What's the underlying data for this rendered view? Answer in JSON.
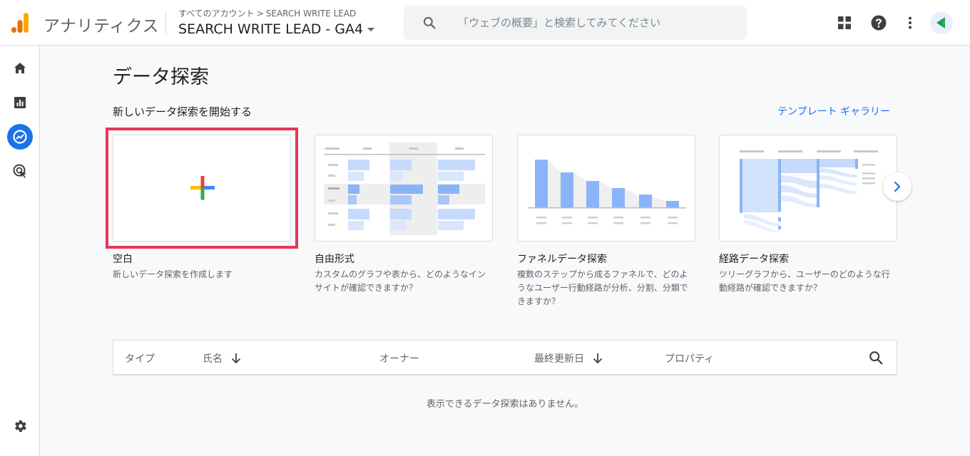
{
  "header": {
    "product_name": "アナリティクス",
    "breadcrumb": {
      "account": "すべてのアカウント",
      "separator": ">",
      "property": "SEARCH WRITE LEAD"
    },
    "property_name": "SEARCH WRITE LEAD - GA4",
    "search_placeholder": "「ウェブの概要」と検索してみてください",
    "icons": [
      "apps-icon",
      "help-icon",
      "more-vert-icon",
      "account-avatar"
    ]
  },
  "sidebar": {
    "items": [
      {
        "name": "home",
        "icon": "home-icon",
        "active": false
      },
      {
        "name": "reports",
        "icon": "reports-icon",
        "active": true
      },
      {
        "name": "explore",
        "icon": "explore-icon",
        "active": true
      },
      {
        "name": "advertising",
        "icon": "advertising-icon",
        "active": false
      },
      {
        "name": "admin",
        "icon": "gear-icon",
        "active": false
      }
    ]
  },
  "main": {
    "title": "データ探索",
    "section_title": "新しいデータ探索を開始する",
    "gallery_link": "テンプレート ギャラリー",
    "templates": [
      {
        "name": "空白",
        "description": "新しいデータ探索を作成します"
      },
      {
        "name": "自由形式",
        "description": "カスタムのグラフや表から、どのようなインサイトが確認できますか？"
      },
      {
        "name": "ファネルデータ探索",
        "description": "複数のステップから成るファネルで、どのようなユーザー行動経路が分析、分割、分類できますか？"
      },
      {
        "name": "経路データ探索",
        "description": "ツリーグラフから、ユーザーのどのような行動経路が確認できますか？"
      }
    ],
    "table": {
      "columns": [
        "タイプ",
        "氏名",
        "オーナー",
        "最終更新日",
        "プロパティ"
      ],
      "empty_message": "表示できるデータ探索はありません。"
    }
  },
  "colors": {
    "accent": "#1a73e8",
    "highlight": "#e8355a",
    "chart_bar": "#8ab4f8",
    "chart_light": "#c6dafc"
  }
}
